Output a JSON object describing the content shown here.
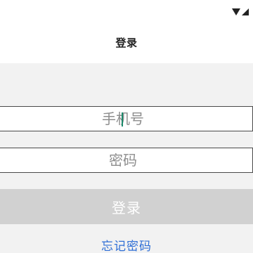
{
  "status_bar": {
    "icons": [
      "wifi-icon",
      "cellular-signal-icon"
    ],
    "icon_color": "#222222"
  },
  "app_bar": {
    "title": "登录"
  },
  "form": {
    "phone_placeholder": "手机号",
    "password_placeholder": "密码",
    "caret_color": "#1b8a6b"
  },
  "actions": {
    "login_label": "登录",
    "login_background": "#d1d1d1",
    "forgot_password_label": "忘记密码",
    "link_color": "#2f6fd6"
  },
  "colors": {
    "content_background": "#f2f2f2",
    "field_border": "#4a4a4a"
  }
}
